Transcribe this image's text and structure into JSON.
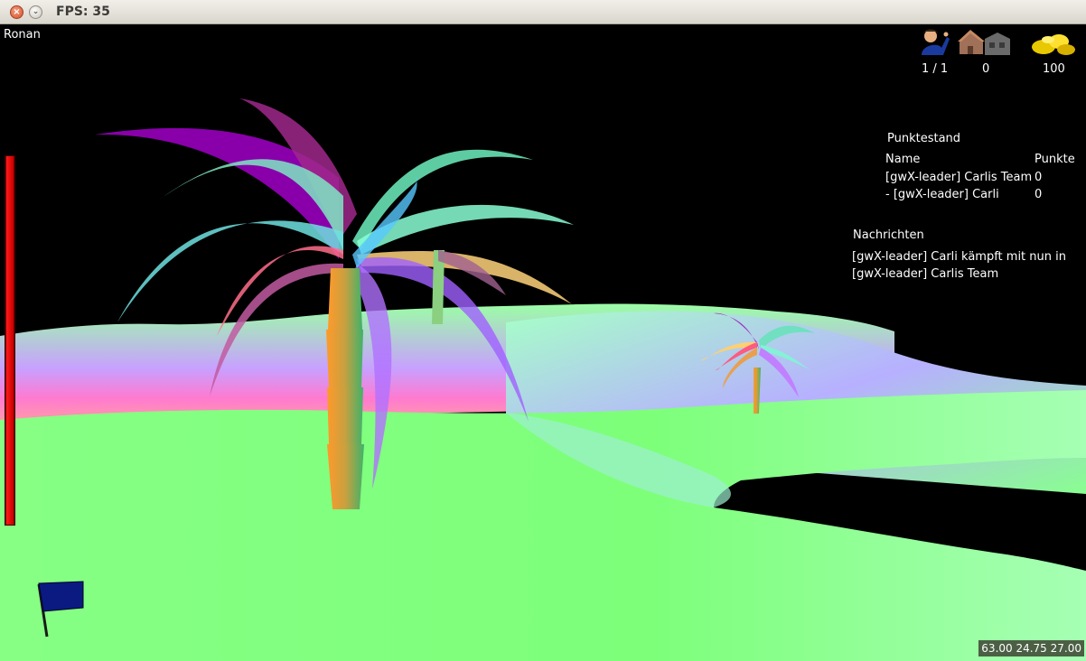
{
  "window": {
    "title": "FPS: 35"
  },
  "player": {
    "name": "Ronan",
    "health": 1.0
  },
  "resources": {
    "units": {
      "icon": "worker-icon",
      "value": "1 / 1"
    },
    "buildings": {
      "icon": "houses-icon",
      "value": "0"
    },
    "gold": {
      "icon": "gold-coins-icon",
      "value": "100"
    }
  },
  "scoreboard": {
    "title": "Punktestand",
    "columns": [
      "Name",
      "Punkte"
    ],
    "rows": [
      {
        "name": "[gwX-leader] Carlis Team",
        "points": "0"
      },
      {
        "name": "- [gwX-leader] Carli",
        "points": "0"
      }
    ]
  },
  "messages": {
    "title": "Nachrichten",
    "lines": [
      "[gwX-leader] Carli kämpft mit nun in",
      "[gwX-leader] Carlis Team"
    ]
  },
  "coordinates": "63.00 24.75 27.00",
  "colors": {
    "ground": "#80ff80",
    "health": "#e00000",
    "flag": "#0a1a80"
  }
}
